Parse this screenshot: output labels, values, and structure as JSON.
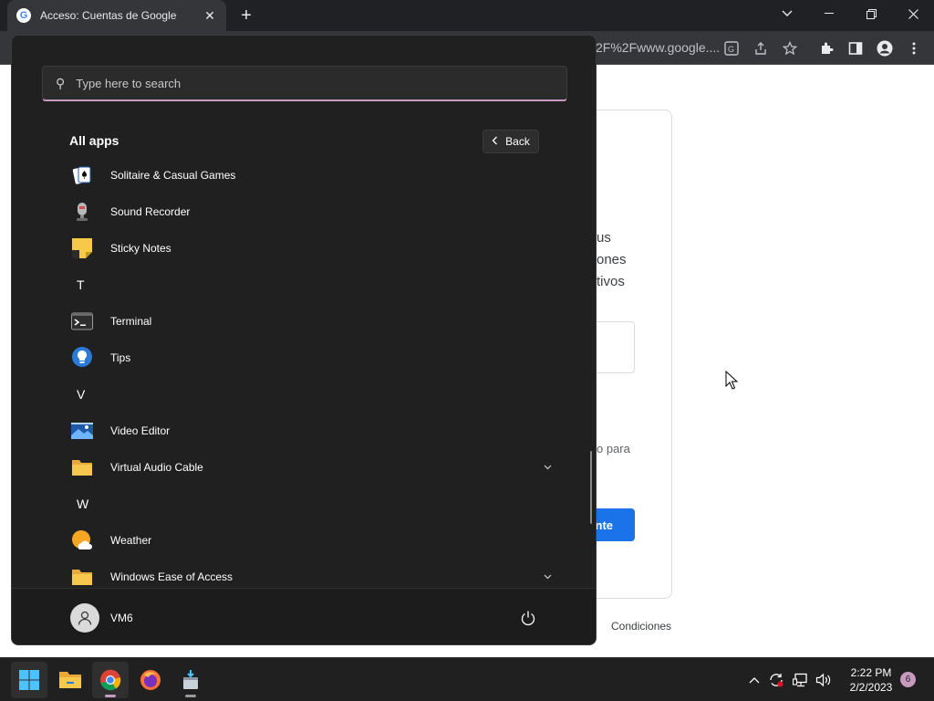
{
  "browser": {
    "tab_title": "Acceso: Cuentas de Google",
    "tab_icon": "google-g-icon",
    "url_fragment": "2F%2Fwww.google....",
    "window_controls": [
      "chevron-down-icon",
      "minimize-icon",
      "restore-icon",
      "close-icon"
    ],
    "toolbar_icons": [
      "translate-icon",
      "share-icon",
      "star-icon",
      "extensions-icon",
      "side-panel-icon",
      "profile-icon",
      "more-icon"
    ]
  },
  "google_page": {
    "text_lines": [
      "us",
      "ones",
      "tivos"
    ],
    "hint_text": "o para",
    "button_label": "nte",
    "footer_link": "Condiciones"
  },
  "start_menu": {
    "search": {
      "placeholder": "Type here to search"
    },
    "all_apps_title": "All apps",
    "back_label": "Back",
    "apps": [
      {
        "kind": "app",
        "label": "Solitaire & Casual Games",
        "icon": "solitaire-icon"
      },
      {
        "kind": "app",
        "label": "Sound Recorder",
        "icon": "microphone-icon"
      },
      {
        "kind": "app",
        "label": "Sticky Notes",
        "icon": "sticky-note-icon"
      },
      {
        "kind": "letter",
        "label": "T"
      },
      {
        "kind": "app",
        "label": "Terminal",
        "icon": "terminal-icon"
      },
      {
        "kind": "app",
        "label": "Tips",
        "icon": "lightbulb-icon"
      },
      {
        "kind": "letter",
        "label": "V"
      },
      {
        "kind": "app",
        "label": "Video Editor",
        "icon": "video-editor-icon"
      },
      {
        "kind": "folder",
        "label": "Virtual Audio Cable",
        "icon": "folder-icon"
      },
      {
        "kind": "letter",
        "label": "W"
      },
      {
        "kind": "app",
        "label": "Weather",
        "icon": "weather-icon"
      },
      {
        "kind": "folder",
        "label": "Windows Ease of Access",
        "icon": "folder-icon"
      }
    ],
    "user": {
      "name": "VM6"
    }
  },
  "taskbar": {
    "apps": [
      {
        "name": "start-button",
        "icon": "windows-logo-icon",
        "active": true
      },
      {
        "name": "file-explorer",
        "icon": "folder-icon",
        "active": false
      },
      {
        "name": "chrome",
        "icon": "chrome-icon",
        "active": true
      },
      {
        "name": "firefox",
        "icon": "firefox-icon",
        "active": false
      },
      {
        "name": "installer",
        "icon": "installer-icon",
        "active": false
      }
    ],
    "tray_icons": [
      "chevron-up-icon",
      "sync-icon",
      "network-icon",
      "volume-icon"
    ],
    "time": "2:22 PM",
    "date": "2/2/2023",
    "notification_count": "6"
  },
  "colors": {
    "accent": "#c79ac0",
    "google_blue": "#1a73e8",
    "menu_bg": "#202020"
  }
}
